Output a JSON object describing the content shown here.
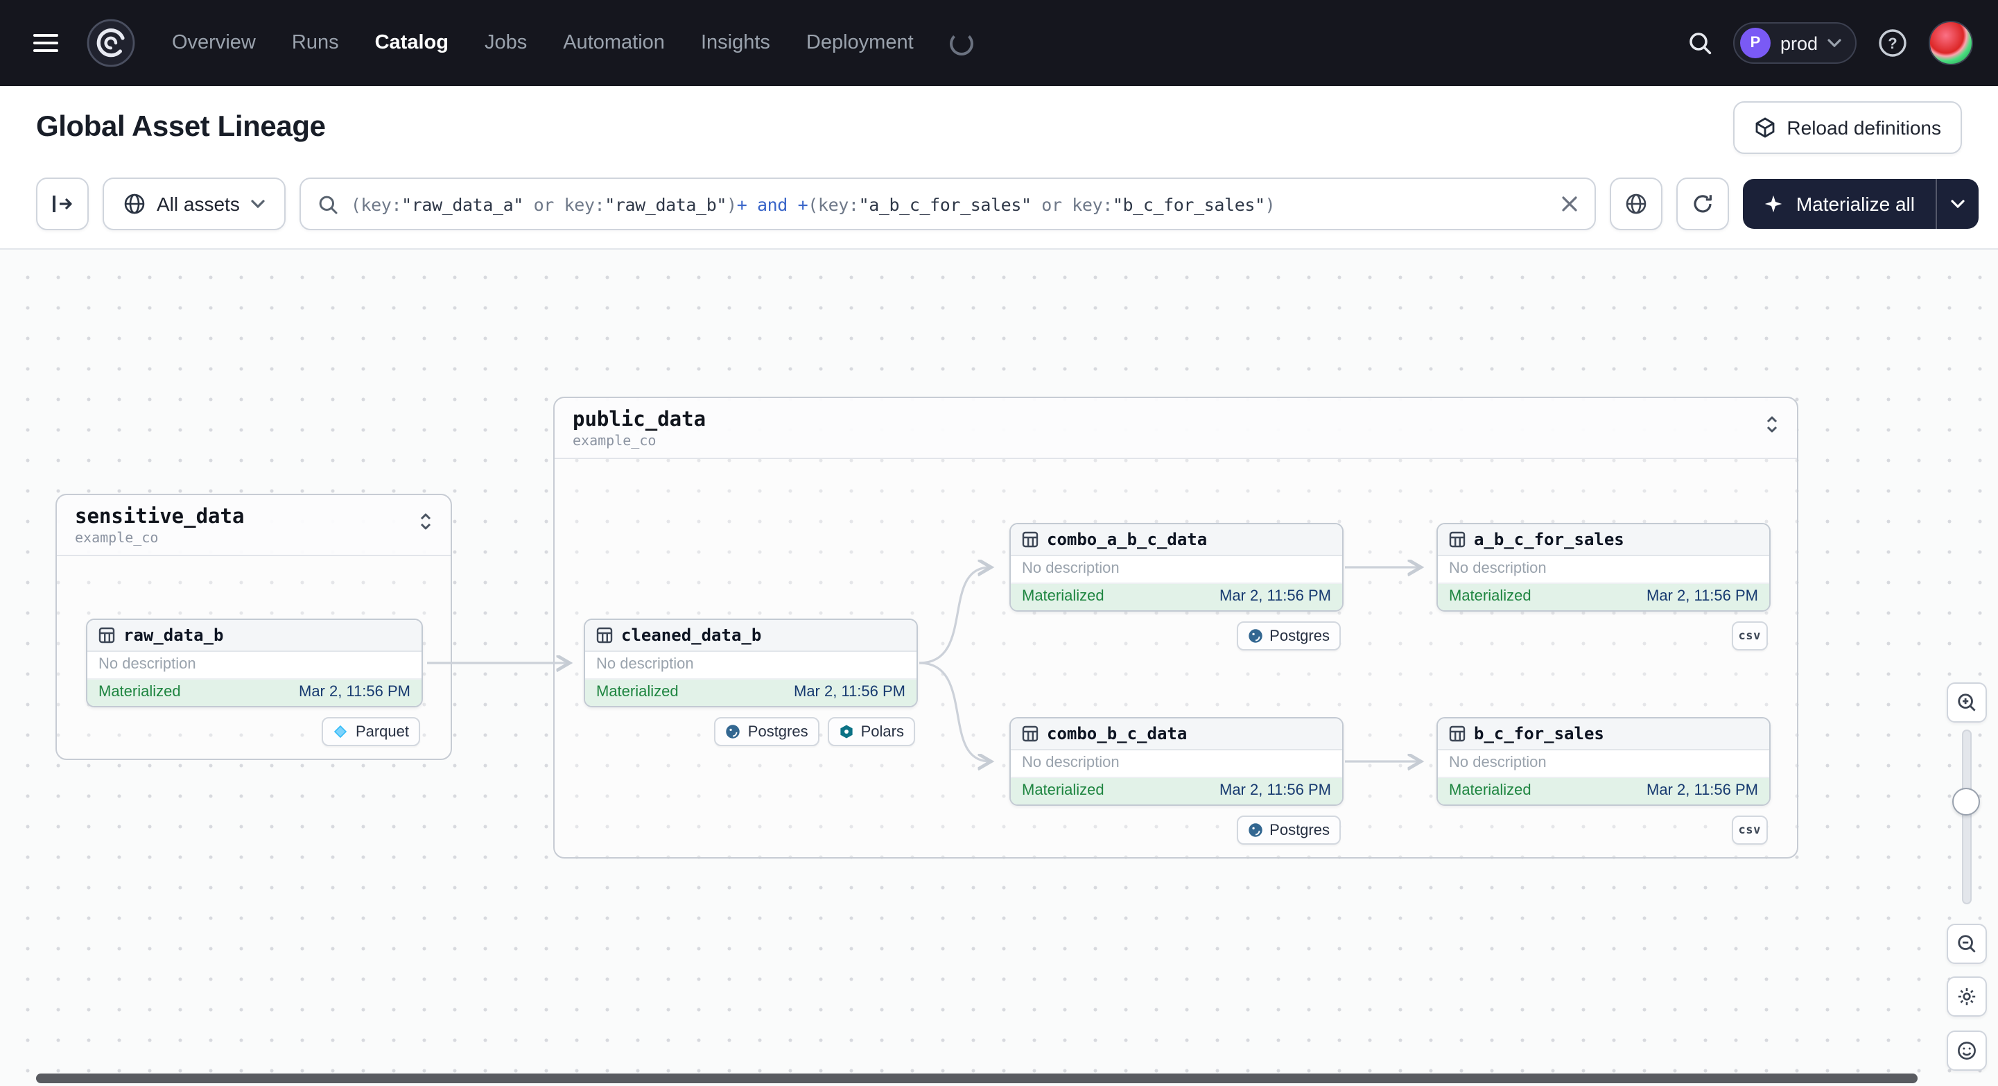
{
  "nav": {
    "items": [
      {
        "label": "Overview",
        "active": false
      },
      {
        "label": "Runs",
        "active": false
      },
      {
        "label": "Catalog",
        "active": true
      },
      {
        "label": "Jobs",
        "active": false
      },
      {
        "label": "Automation",
        "active": false
      },
      {
        "label": "Insights",
        "active": false
      },
      {
        "label": "Deployment",
        "active": false
      }
    ],
    "deployment": {
      "env_initial": "P",
      "env_name": "prod"
    }
  },
  "header": {
    "title": "Global Asset Lineage",
    "reload_button": "Reload definitions"
  },
  "toolbar": {
    "scope": "All assets",
    "materialize": "Materialize all",
    "query_tokens": [
      {
        "t": "(key:",
        "c": "p"
      },
      {
        "t": "\"raw_data_a\"",
        "c": "s"
      },
      {
        "t": " or key:",
        "c": "p"
      },
      {
        "t": "\"raw_data_b\"",
        "c": "s"
      },
      {
        "t": ")",
        "c": "p"
      },
      {
        "t": "+",
        "c": "o"
      },
      {
        "t": " and ",
        "c": "o"
      },
      {
        "t": "+",
        "c": "o"
      },
      {
        "t": "(key:",
        "c": "p"
      },
      {
        "t": "\"a_b_c_for_sales\"",
        "c": "s"
      },
      {
        "t": " or key:",
        "c": "p"
      },
      {
        "t": "\"b_c_for_sales\"",
        "c": "s"
      },
      {
        "t": ")",
        "c": "p"
      }
    ]
  },
  "graph": {
    "groups": [
      {
        "name": "sensitive_data",
        "location": "example_co"
      },
      {
        "name": "public_data",
        "location": "example_co"
      }
    ],
    "nodes": [
      {
        "name": "raw_data_b",
        "description": "No description",
        "status": "Materialized",
        "timestamp": "Mar 2, 11:56 PM"
      },
      {
        "name": "cleaned_data_b",
        "description": "No description",
        "status": "Materialized",
        "timestamp": "Mar 2, 11:56 PM"
      },
      {
        "name": "combo_a_b_c_data",
        "description": "No description",
        "status": "Materialized",
        "timestamp": "Mar 2, 11:56 PM"
      },
      {
        "name": "combo_b_c_data",
        "description": "No description",
        "status": "Materialized",
        "timestamp": "Mar 2, 11:56 PM"
      },
      {
        "name": "a_b_c_for_sales",
        "description": "No description",
        "status": "Materialized",
        "timestamp": "Mar 2, 11:56 PM"
      },
      {
        "name": "b_c_for_sales",
        "description": "No description",
        "status": "Materialized",
        "timestamp": "Mar 2, 11:56 PM"
      }
    ],
    "kinds": {
      "parquet": "Parquet",
      "postgres": "Postgres",
      "polars": "Polars",
      "csv": "csv"
    }
  },
  "colors": {
    "nav_bg": "#15161e",
    "materialized_bg": "#e2f2e8",
    "materialized_text": "#1e8540",
    "timestamp_text": "#173a70",
    "materialize_button_bg": "#1b2138",
    "env_badge": "#7a5af5",
    "edge": "#ccd1d9"
  }
}
